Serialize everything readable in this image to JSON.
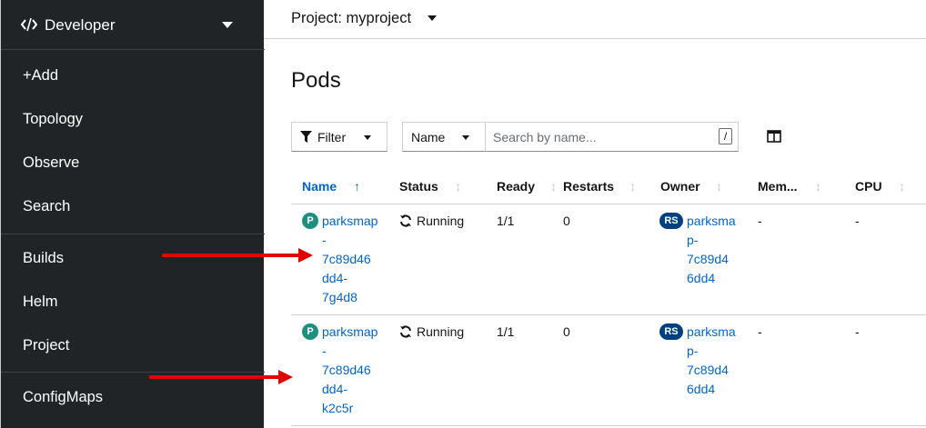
{
  "sidebar": {
    "perspective": "Developer",
    "items": [
      {
        "label": "+Add"
      },
      {
        "label": "Topology"
      },
      {
        "label": "Observe"
      },
      {
        "label": "Search"
      },
      {
        "label": "Builds"
      },
      {
        "label": "Helm"
      },
      {
        "label": "Project"
      },
      {
        "label": "ConfigMaps"
      }
    ]
  },
  "masthead": {
    "project_label": "Project: myproject"
  },
  "page": {
    "title": "Pods"
  },
  "toolbar": {
    "filter_label": "Filter",
    "name_select": "Name",
    "search_placeholder": "Search by name...",
    "search_value": "",
    "kbd_shortcut": "/"
  },
  "table": {
    "columns": [
      "Name",
      "Status",
      "Ready",
      "Restarts",
      "Owner",
      "Mem...",
      "CPU"
    ],
    "sorted_column": "Name",
    "rows": [
      {
        "badge": "P",
        "name": "parksmap\n-\n7c89d46\ndd4-\n7g4d8",
        "status": "Running",
        "ready": "1/1",
        "restarts": "0",
        "owner_badge": "RS",
        "owner": "parksma\np-\n7c89d4\n6dd4",
        "memory": "-",
        "cpu": "-"
      },
      {
        "badge": "P",
        "name": "parksmap\n-\n7c89d46\ndd4-\nk2c5r",
        "status": "Running",
        "ready": "1/1",
        "restarts": "0",
        "owner_badge": "RS",
        "owner": "parksma\np-\n7c89d4\n6dd4",
        "memory": "-",
        "cpu": "-"
      }
    ]
  },
  "colors": {
    "sidebar_bg": "#212427",
    "link": "#0066cc",
    "pod_badge": "#1e8f7e",
    "rs_badge": "#004080",
    "annotation_arrow": "#e00000"
  }
}
